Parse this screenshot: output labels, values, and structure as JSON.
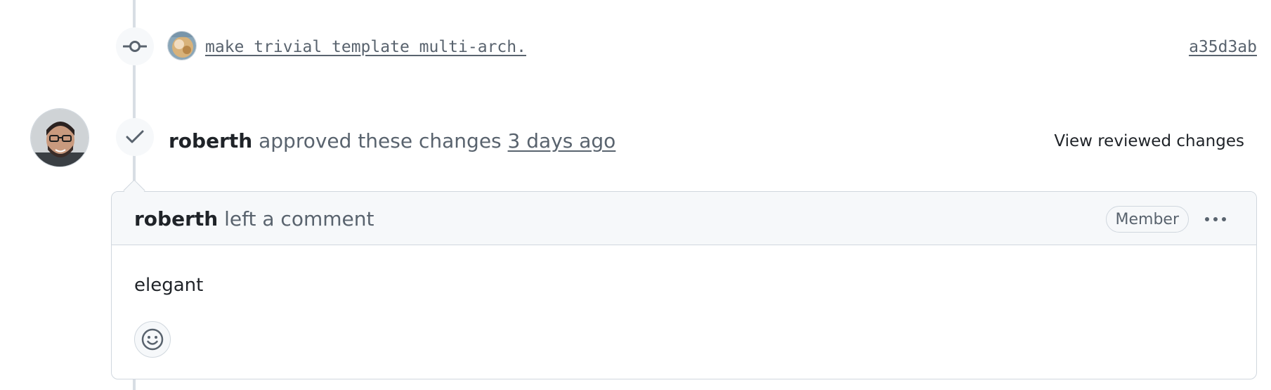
{
  "commit": {
    "message": "make trivial template multi-arch.",
    "sha": "a35d3ab",
    "icon": "git-commit-icon"
  },
  "review": {
    "author": "roberth",
    "action": "approved these changes",
    "time": "3 days ago",
    "view_changes_label": "View reviewed changes",
    "icon": "check-icon"
  },
  "comment": {
    "author": "roberth",
    "action": "left a comment",
    "role_badge": "Member",
    "body": "elegant",
    "menu_icon": "kebab-horizontal-icon",
    "reaction_icon": "smiley-icon"
  },
  "colors": {
    "muted_text": "#59636e",
    "border": "#d0d7de",
    "header_bg": "#f6f8fa",
    "timeline": "#d8dee4"
  }
}
